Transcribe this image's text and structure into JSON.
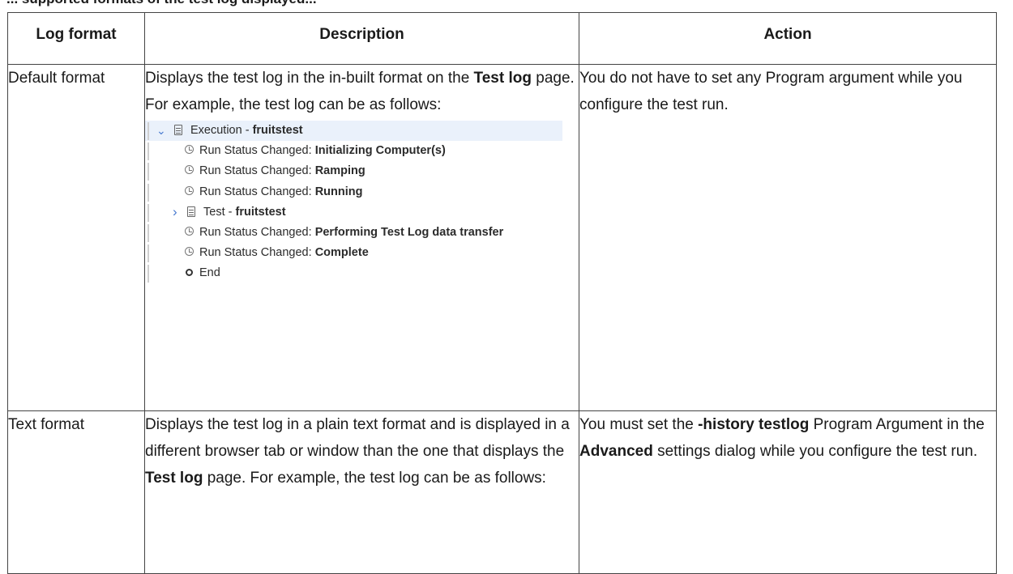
{
  "caption": "... supported formats of the test log displayed...",
  "table": {
    "headers": [
      "Log format",
      "Description",
      "Action"
    ],
    "rows": [
      {
        "format": "Default format",
        "description": {
          "p1": "Displays the test log in the in-built format on the ",
          "b1": "Test log",
          "p2": " page. For example, the test log can be as follows:"
        },
        "action": {
          "p1": "You do not have to set any Program argument while you configure the test run."
        }
      },
      {
        "format": "Text format",
        "description": {
          "p1": "Displays the test log in a plain text format and is displayed in a different browser tab or window than the one that displays the ",
          "b1": "Test log",
          "p2": " page. For example, the test log can be as follows:"
        },
        "action": {
          "p1": "You must set the ",
          "b1": "-history testlog",
          "p2": " Program Argu­ment in the ",
          "b2": "Advanced",
          "p3": " settings dialog while you configure the test run."
        }
      }
    ]
  },
  "log_tree": {
    "execution": {
      "prefix": "Execution - ",
      "name": "fruitstest"
    },
    "status_prefix": "Run Status Changed: ",
    "status1": "Initializing Computer(s)",
    "status2": "Ramping",
    "status3": "Running",
    "test": {
      "prefix": "Test - ",
      "name": "fruitstest"
    },
    "status4": "Performing Test Log data transfer",
    "status5": "Complete",
    "end": "End"
  }
}
